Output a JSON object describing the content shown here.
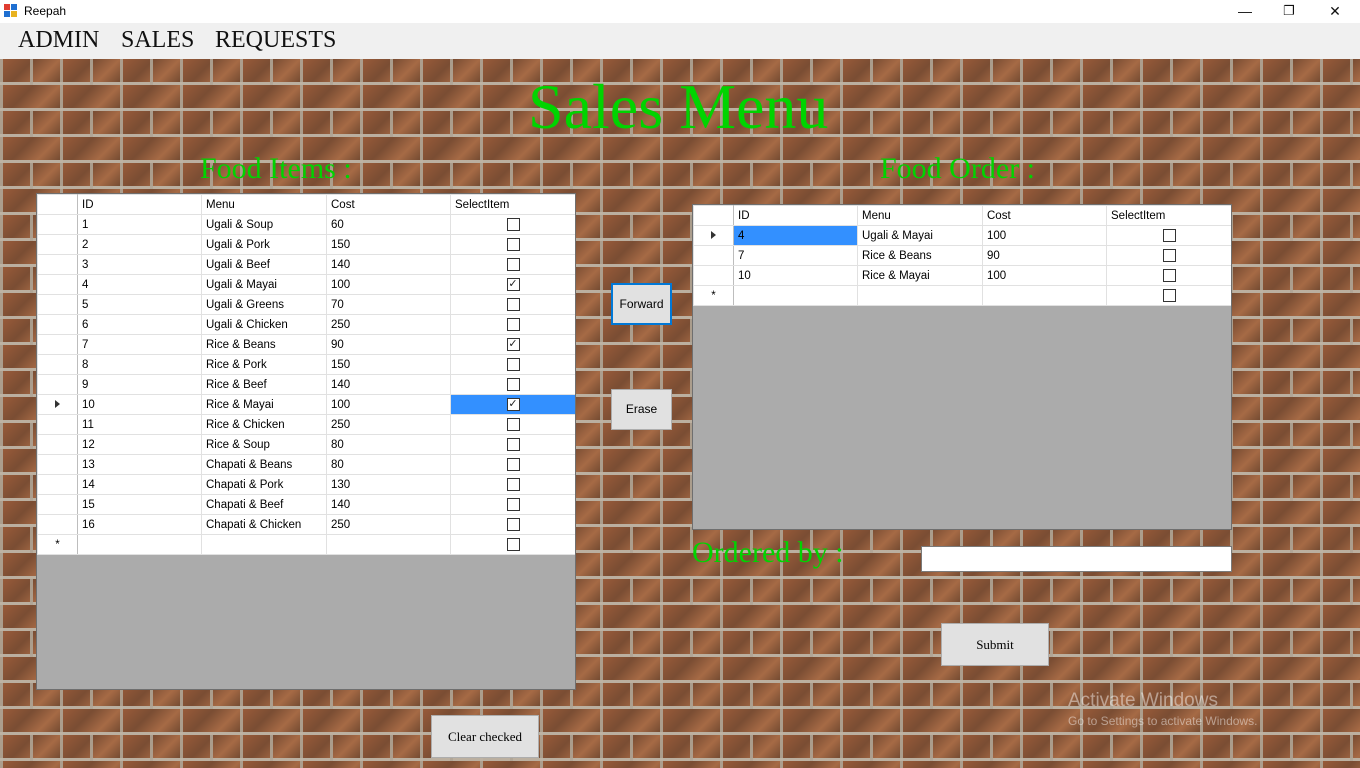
{
  "window": {
    "title": "Reepah",
    "minimize": "—",
    "maximize": "❐",
    "close": "✕"
  },
  "menu": [
    "ADMIN",
    "SALES",
    "REQUESTS"
  ],
  "page_title": "Sales Menu",
  "food_items": {
    "heading": "Food Items :",
    "columns": [
      "ID",
      "Menu",
      "Cost",
      "SelectItem"
    ],
    "rows": [
      {
        "id": "1",
        "menu": "Ugali & Soup",
        "cost": "60",
        "checked": false
      },
      {
        "id": "2",
        "menu": "Ugali & Pork",
        "cost": "150",
        "checked": false
      },
      {
        "id": "3",
        "menu": "Ugali & Beef",
        "cost": "140",
        "checked": false
      },
      {
        "id": "4",
        "menu": "Ugali & Mayai",
        "cost": "100",
        "checked": true
      },
      {
        "id": "5",
        "menu": "Ugali & Greens",
        "cost": "70",
        "checked": false
      },
      {
        "id": "6",
        "menu": "Ugali & Chicken",
        "cost": "250",
        "checked": false
      },
      {
        "id": "7",
        "menu": "Rice & Beans",
        "cost": "90",
        "checked": true
      },
      {
        "id": "8",
        "menu": "Rice & Pork",
        "cost": "150",
        "checked": false
      },
      {
        "id": "9",
        "menu": "Rice & Beef",
        "cost": "140",
        "checked": false
      },
      {
        "id": "10",
        "menu": "Rice & Mayai",
        "cost": "100",
        "checked": true
      },
      {
        "id": "11",
        "menu": "Rice & Chicken",
        "cost": "250",
        "checked": false
      },
      {
        "id": "12",
        "menu": "Rice & Soup",
        "cost": "80",
        "checked": false
      },
      {
        "id": "13",
        "menu": "Chapati & Beans",
        "cost": "80",
        "checked": false
      },
      {
        "id": "14",
        "menu": "Chapati & Pork",
        "cost": "130",
        "checked": false
      },
      {
        "id": "15",
        "menu": "Chapati & Beef",
        "cost": "140",
        "checked": false
      },
      {
        "id": "16",
        "menu": "Chapati & Chicken",
        "cost": "250",
        "checked": false
      }
    ],
    "current_row": "10",
    "new_row_marker": "*"
  },
  "food_order": {
    "heading": "Food Order :",
    "columns": [
      "ID",
      "Menu",
      "Cost",
      "SelectItem"
    ],
    "rows": [
      {
        "id": "4",
        "menu": "Ugali & Mayai",
        "cost": "100",
        "checked": false
      },
      {
        "id": "7",
        "menu": "Rice & Beans",
        "cost": "90",
        "checked": false
      },
      {
        "id": "10",
        "menu": "Rice & Mayai",
        "cost": "100",
        "checked": false
      }
    ],
    "current_row": "4",
    "new_row_marker": "*"
  },
  "buttons": {
    "forward": "Forward",
    "erase": "Erase",
    "submit": "Submit",
    "clear_checked": "Clear checked"
  },
  "ordered_by": {
    "label": "Ordered by :",
    "value": ""
  },
  "watermark": {
    "line1": "Activate Windows",
    "line2": "Go to Settings to activate Windows."
  },
  "colors": {
    "green_text": "#00d400",
    "selection": "#3390ff"
  }
}
